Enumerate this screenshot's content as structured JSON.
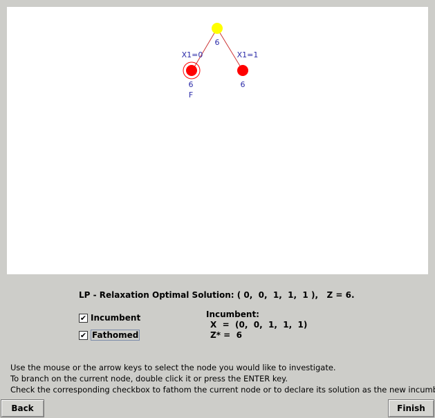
{
  "tree": {
    "root": {
      "value": "6",
      "color": "#ffff00"
    },
    "children": [
      {
        "branch_label": "X1=0",
        "value": "6",
        "status": "F",
        "color": "#ff0000",
        "selected": true
      },
      {
        "branch_label": "X1=1",
        "value": "6",
        "status": "",
        "color": "#ff0000",
        "selected": false
      }
    ],
    "label_color": "#2a2aa8",
    "edge_color": "#cc3333"
  },
  "lp": {
    "text": "LP - Relaxation Optimal Solution: ( 0,  0,  1,  1,  1 ),   Z = 6."
  },
  "checkboxes": {
    "incumbent": {
      "label": "Incumbent",
      "checked": "✔"
    },
    "fathomed": {
      "label": "Fathomed",
      "checked": "✔"
    }
  },
  "incumbent": {
    "title": "Incumbent:",
    "x_line": "X  =  (0,  0,  1,  1,  1)",
    "z_line": "Z* =  6"
  },
  "instructions": [
    "Use the mouse or the arrow keys to select the node you would like to investigate.",
    "To branch on the current node, double click it or press the ENTER key.",
    "Check the corresponding checkbox to fathom the current node or to declare its solution as the new incumbent."
  ],
  "buttons": {
    "back": "Back",
    "finish": "Finish"
  }
}
